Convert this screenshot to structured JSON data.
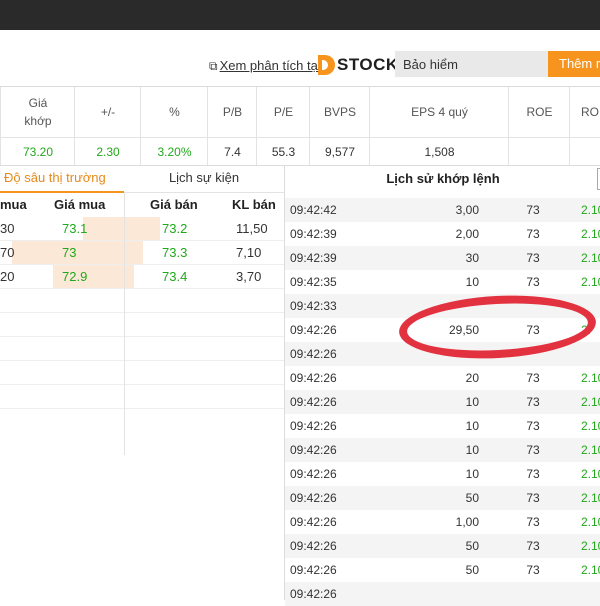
{
  "header": {
    "analysis_link": "Xem phân tích tại",
    "brand": "STOCK",
    "search_value": "Bảo hiểm",
    "add_button": "Thêm m"
  },
  "metrics": {
    "columns": [
      {
        "label": "Giá\nkhớp",
        "value": "73.20",
        "green": true
      },
      {
        "label": "+/-",
        "value": "2.30",
        "green": true
      },
      {
        "label": "%",
        "value": "3.20%",
        "green": true
      },
      {
        "label": "P/B",
        "value": "7.4",
        "green": false
      },
      {
        "label": "P/E",
        "value": "55.3",
        "green": false
      },
      {
        "label": "BVPS",
        "value": "9,577",
        "green": false
      },
      {
        "label": "EPS 4 quý",
        "value": "1,508",
        "green": false
      },
      {
        "label": "ROE",
        "value": "",
        "green": false
      },
      {
        "label": "RO",
        "value": "",
        "green": false
      }
    ]
  },
  "depth": {
    "tab_active": "Độ sâu thị trường",
    "tab_other": "Lịch sự kiện",
    "headers": {
      "qty_buy": "mua",
      "price_buy": "Giá mua",
      "price_sell": "Giá bán",
      "qty_sell": "KL bán"
    },
    "rows": [
      {
        "qty_buy": "30",
        "price_buy": "73.1",
        "price_sell": "73.2",
        "qty_sell": "11,50",
        "buy_fill": 0.35,
        "sell_fill": 0.3
      },
      {
        "qty_buy": "70",
        "price_buy": "73",
        "price_sell": "73.3",
        "qty_sell": "7,10",
        "buy_fill": 0.95,
        "sell_fill": 0.15
      },
      {
        "qty_buy": "20",
        "price_buy": "72.9",
        "price_sell": "73.4",
        "qty_sell": "3,70",
        "buy_fill": 0.6,
        "sell_fill": 0.08
      }
    ]
  },
  "history": {
    "title": "Lịch sử khớp lệnh",
    "rows": [
      {
        "time": "09:42:42",
        "qty": "3,00",
        "price": "73",
        "change": "2.10"
      },
      {
        "time": "09:42:39",
        "qty": "2,00",
        "price": "73",
        "change": "2.10"
      },
      {
        "time": "09:42:39",
        "qty": "30",
        "price": "73",
        "change": "2.10"
      },
      {
        "time": "09:42:35",
        "qty": "10",
        "price": "73",
        "change": "2.10"
      },
      {
        "time": "09:42:33",
        "qty": "",
        "price": "",
        "change": ""
      },
      {
        "time": "09:42:26",
        "qty": "29,50",
        "price": "73",
        "change": "2."
      },
      {
        "time": "09:42:26",
        "qty": "",
        "price": "",
        "change": ""
      },
      {
        "time": "09:42:26",
        "qty": "20",
        "price": "73",
        "change": "2.10"
      },
      {
        "time": "09:42:26",
        "qty": "10",
        "price": "73",
        "change": "2.10"
      },
      {
        "time": "09:42:26",
        "qty": "10",
        "price": "73",
        "change": "2.10"
      },
      {
        "time": "09:42:26",
        "qty": "10",
        "price": "73",
        "change": "2.10"
      },
      {
        "time": "09:42:26",
        "qty": "10",
        "price": "73",
        "change": "2.10"
      },
      {
        "time": "09:42:26",
        "qty": "50",
        "price": "73",
        "change": "2.10"
      },
      {
        "time": "09:42:26",
        "qty": "1,00",
        "price": "73",
        "change": "2.10"
      },
      {
        "time": "09:42:26",
        "qty": "50",
        "price": "73",
        "change": "2.10"
      },
      {
        "time": "09:42:26",
        "qty": "50",
        "price": "73",
        "change": "2.10"
      },
      {
        "time": "09:42:26",
        "qty": "",
        "price": "",
        "change": ""
      }
    ]
  },
  "colors": {
    "accent": "#f7941d",
    "up": "#22a81c",
    "marker": "#e3323f"
  }
}
